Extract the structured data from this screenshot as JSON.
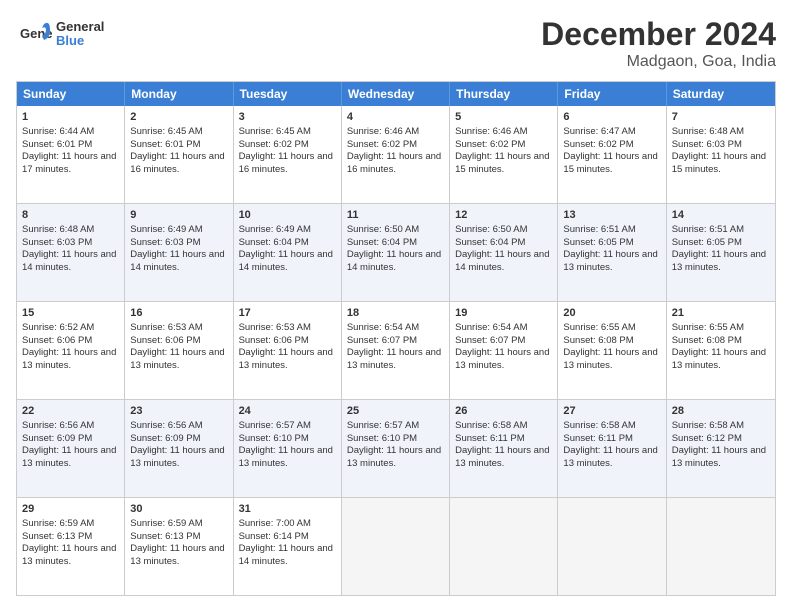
{
  "header": {
    "logo_general": "General",
    "logo_blue": "Blue",
    "month_title": "December 2024",
    "location": "Madgaon, Goa, India"
  },
  "days_of_week": [
    "Sunday",
    "Monday",
    "Tuesday",
    "Wednesday",
    "Thursday",
    "Friday",
    "Saturday"
  ],
  "weeks": [
    [
      {
        "day": "1",
        "info": "Sunrise: 6:44 AM\nSunset: 6:01 PM\nDaylight: 11 hours and 17 minutes."
      },
      {
        "day": "2",
        "info": "Sunrise: 6:45 AM\nSunset: 6:01 PM\nDaylight: 11 hours and 16 minutes."
      },
      {
        "day": "3",
        "info": "Sunrise: 6:45 AM\nSunset: 6:02 PM\nDaylight: 11 hours and 16 minutes."
      },
      {
        "day": "4",
        "info": "Sunrise: 6:46 AM\nSunset: 6:02 PM\nDaylight: 11 hours and 16 minutes."
      },
      {
        "day": "5",
        "info": "Sunrise: 6:46 AM\nSunset: 6:02 PM\nDaylight: 11 hours and 15 minutes."
      },
      {
        "day": "6",
        "info": "Sunrise: 6:47 AM\nSunset: 6:02 PM\nDaylight: 11 hours and 15 minutes."
      },
      {
        "day": "7",
        "info": "Sunrise: 6:48 AM\nSunset: 6:03 PM\nDaylight: 11 hours and 15 minutes."
      }
    ],
    [
      {
        "day": "8",
        "info": "Sunrise: 6:48 AM\nSunset: 6:03 PM\nDaylight: 11 hours and 14 minutes."
      },
      {
        "day": "9",
        "info": "Sunrise: 6:49 AM\nSunset: 6:03 PM\nDaylight: 11 hours and 14 minutes."
      },
      {
        "day": "10",
        "info": "Sunrise: 6:49 AM\nSunset: 6:04 PM\nDaylight: 11 hours and 14 minutes."
      },
      {
        "day": "11",
        "info": "Sunrise: 6:50 AM\nSunset: 6:04 PM\nDaylight: 11 hours and 14 minutes."
      },
      {
        "day": "12",
        "info": "Sunrise: 6:50 AM\nSunset: 6:04 PM\nDaylight: 11 hours and 14 minutes."
      },
      {
        "day": "13",
        "info": "Sunrise: 6:51 AM\nSunset: 6:05 PM\nDaylight: 11 hours and 13 minutes."
      },
      {
        "day": "14",
        "info": "Sunrise: 6:51 AM\nSunset: 6:05 PM\nDaylight: 11 hours and 13 minutes."
      }
    ],
    [
      {
        "day": "15",
        "info": "Sunrise: 6:52 AM\nSunset: 6:06 PM\nDaylight: 11 hours and 13 minutes."
      },
      {
        "day": "16",
        "info": "Sunrise: 6:53 AM\nSunset: 6:06 PM\nDaylight: 11 hours and 13 minutes."
      },
      {
        "day": "17",
        "info": "Sunrise: 6:53 AM\nSunset: 6:06 PM\nDaylight: 11 hours and 13 minutes."
      },
      {
        "day": "18",
        "info": "Sunrise: 6:54 AM\nSunset: 6:07 PM\nDaylight: 11 hours and 13 minutes."
      },
      {
        "day": "19",
        "info": "Sunrise: 6:54 AM\nSunset: 6:07 PM\nDaylight: 11 hours and 13 minutes."
      },
      {
        "day": "20",
        "info": "Sunrise: 6:55 AM\nSunset: 6:08 PM\nDaylight: 11 hours and 13 minutes."
      },
      {
        "day": "21",
        "info": "Sunrise: 6:55 AM\nSunset: 6:08 PM\nDaylight: 11 hours and 13 minutes."
      }
    ],
    [
      {
        "day": "22",
        "info": "Sunrise: 6:56 AM\nSunset: 6:09 PM\nDaylight: 11 hours and 13 minutes."
      },
      {
        "day": "23",
        "info": "Sunrise: 6:56 AM\nSunset: 6:09 PM\nDaylight: 11 hours and 13 minutes."
      },
      {
        "day": "24",
        "info": "Sunrise: 6:57 AM\nSunset: 6:10 PM\nDaylight: 11 hours and 13 minutes."
      },
      {
        "day": "25",
        "info": "Sunrise: 6:57 AM\nSunset: 6:10 PM\nDaylight: 11 hours and 13 minutes."
      },
      {
        "day": "26",
        "info": "Sunrise: 6:58 AM\nSunset: 6:11 PM\nDaylight: 11 hours and 13 minutes."
      },
      {
        "day": "27",
        "info": "Sunrise: 6:58 AM\nSunset: 6:11 PM\nDaylight: 11 hours and 13 minutes."
      },
      {
        "day": "28",
        "info": "Sunrise: 6:58 AM\nSunset: 6:12 PM\nDaylight: 11 hours and 13 minutes."
      }
    ],
    [
      {
        "day": "29",
        "info": "Sunrise: 6:59 AM\nSunset: 6:13 PM\nDaylight: 11 hours and 13 minutes."
      },
      {
        "day": "30",
        "info": "Sunrise: 6:59 AM\nSunset: 6:13 PM\nDaylight: 11 hours and 13 minutes."
      },
      {
        "day": "31",
        "info": "Sunrise: 7:00 AM\nSunset: 6:14 PM\nDaylight: 11 hours and 14 minutes."
      },
      {
        "day": "",
        "info": ""
      },
      {
        "day": "",
        "info": ""
      },
      {
        "day": "",
        "info": ""
      },
      {
        "day": "",
        "info": ""
      }
    ]
  ]
}
